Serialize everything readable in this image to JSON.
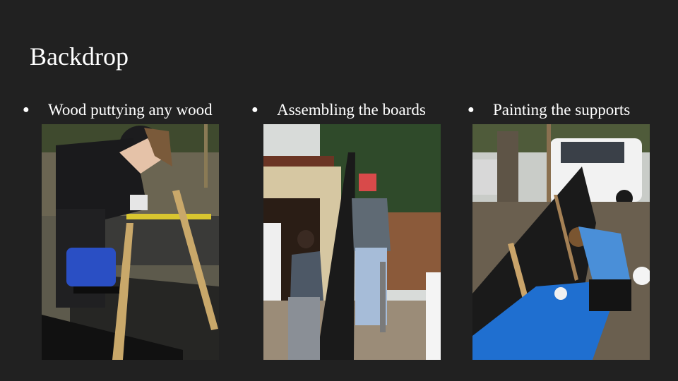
{
  "slide": {
    "title": "Backdrop",
    "bullets": [
      {
        "text": "Wood puttying any wood"
      },
      {
        "text": "Assembling the boards"
      },
      {
        "text": "Painting the supports"
      }
    ],
    "bullet_glyph": "●"
  },
  "colors": {
    "background": "#212121",
    "text": "#ffffff",
    "tarp_blue": "#1f6fd0",
    "sander_blue": "#2a4fc4",
    "board_black": "#1a1a1a"
  }
}
